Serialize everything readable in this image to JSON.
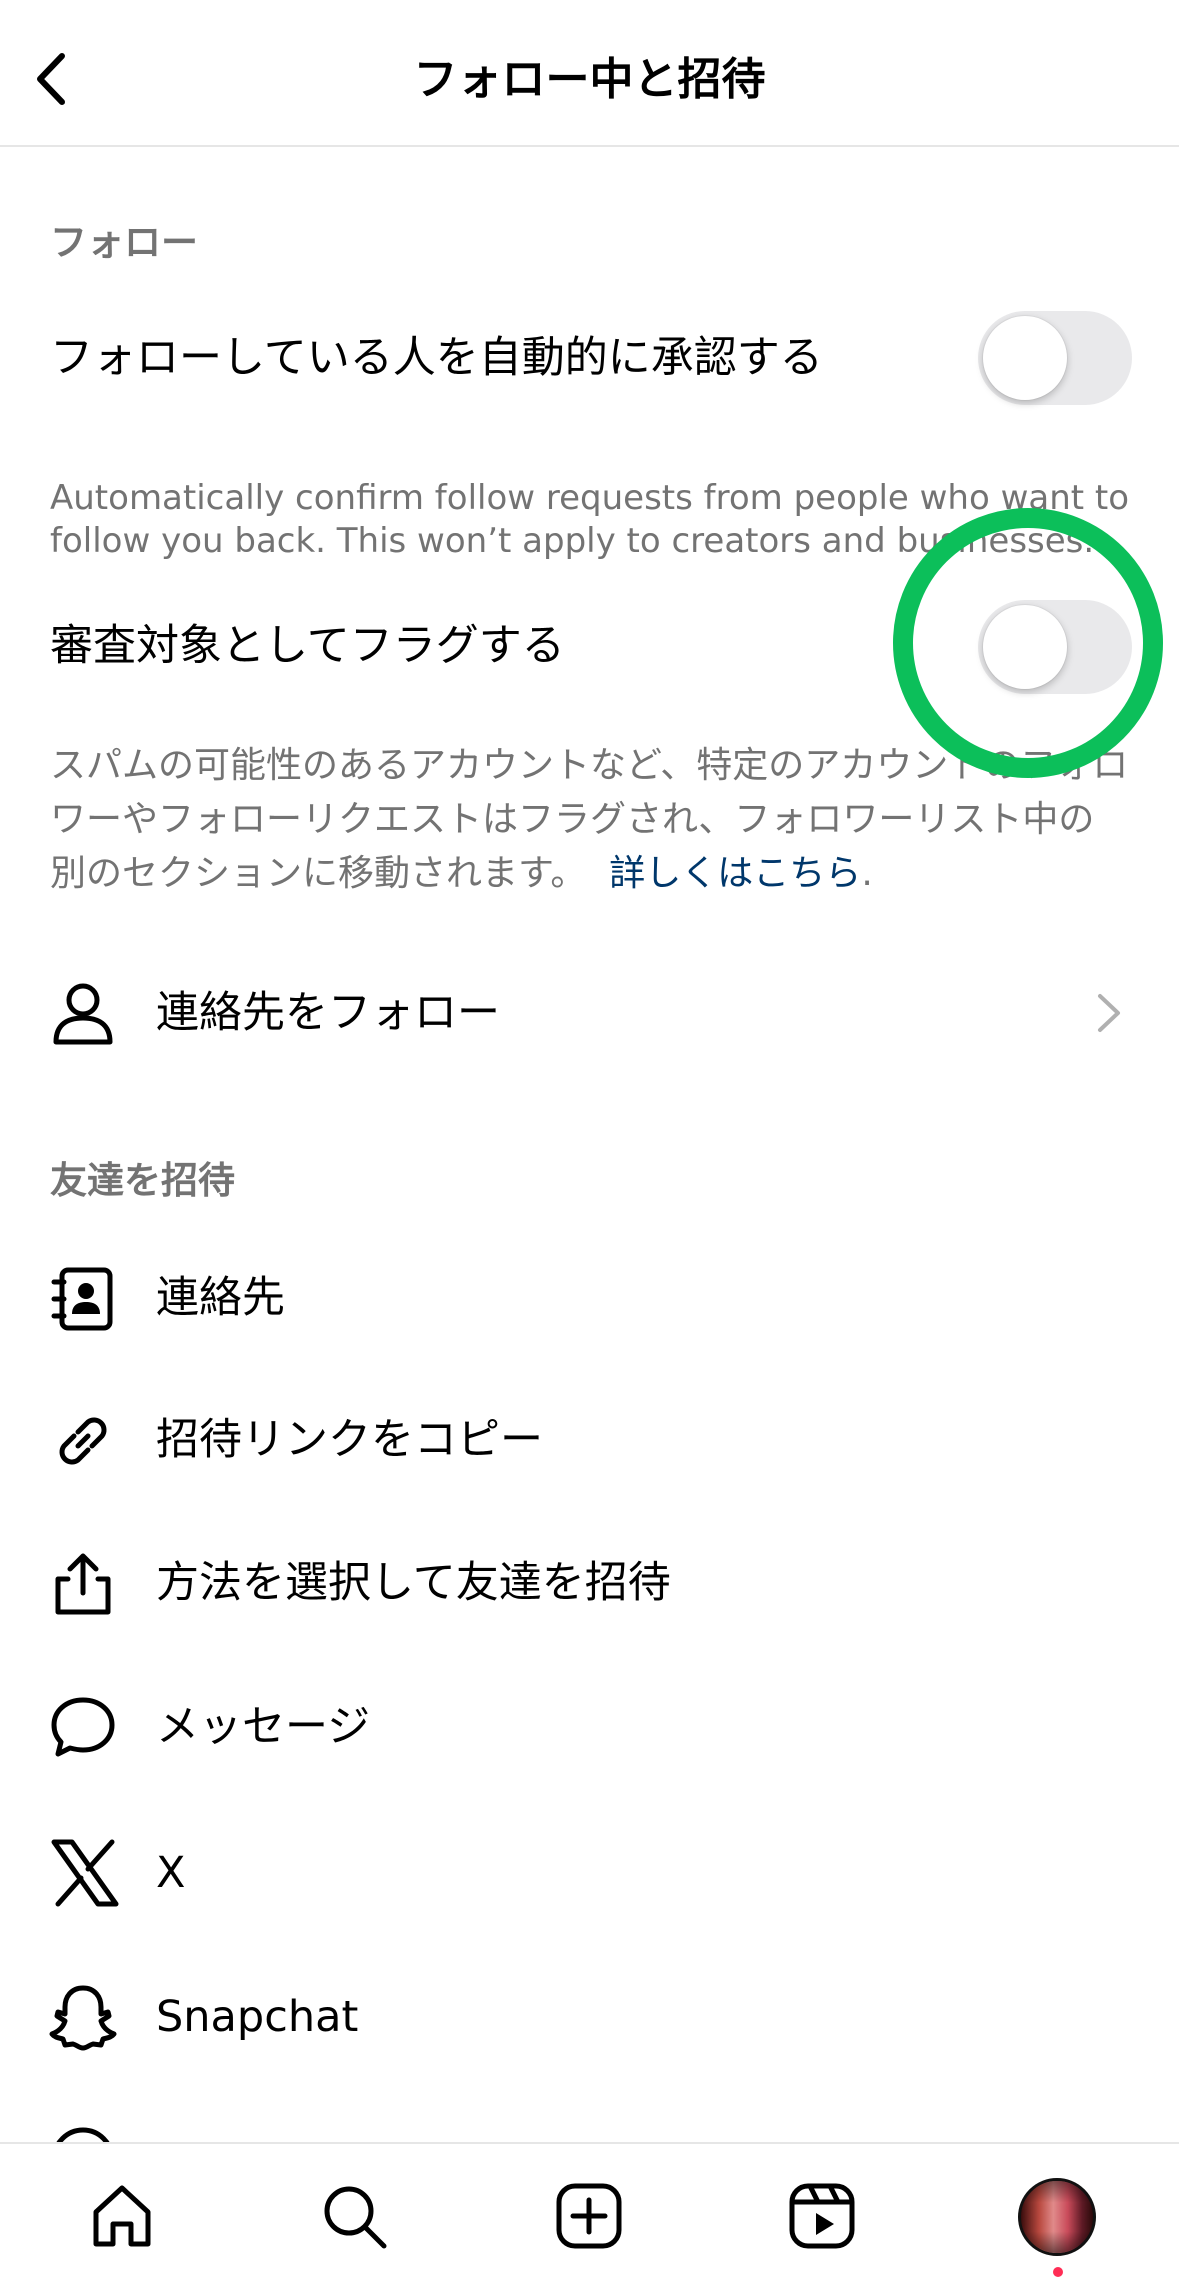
{
  "header": {
    "title": "フォロー中と招待"
  },
  "follow_section": {
    "heading": "フォロー",
    "auto_approve": {
      "label": "フォローしている人を自動的に承認する",
      "description": "Automatically confirm follow requests from people who want to follow you back. This won’t apply to creators and businesses.",
      "enabled": false
    },
    "flag_review": {
      "label": "審査対象としてフラグする",
      "description": "スパムの可能性のあるアカウントなど、特定のアカウントのフォロワーやフォローリクエストはフラグされ、フォロワーリスト中の別のセクションに移動されます。",
      "link_text": "詳しくはこちら",
      "link_suffix": ".",
      "enabled": false
    },
    "follow_contacts": {
      "label": "連絡先をフォロー",
      "icon": "person-icon"
    }
  },
  "invite_section": {
    "heading": "友達を招待",
    "items": [
      {
        "label": "連絡先",
        "icon": "contact-book-icon"
      },
      {
        "label": "招待リンクをコピー",
        "icon": "link-icon"
      },
      {
        "label": "方法を選択して友達を招待",
        "icon": "share-icon"
      },
      {
        "label": "メッセージ",
        "icon": "message-bubble-icon"
      },
      {
        "label": "X",
        "icon": "x-logo-icon"
      },
      {
        "label": "Snapchat",
        "icon": "snapchat-ghost-icon"
      }
    ]
  },
  "tabbar": {
    "items": [
      "home-icon",
      "search-icon",
      "create-icon",
      "reels-icon",
      "profile-avatar"
    ],
    "notification_dot_color": "#ff2d55"
  },
  "colors": {
    "highlight_circle": "#0cbf5a",
    "link": "#00376b",
    "secondary_text": "#737373"
  }
}
